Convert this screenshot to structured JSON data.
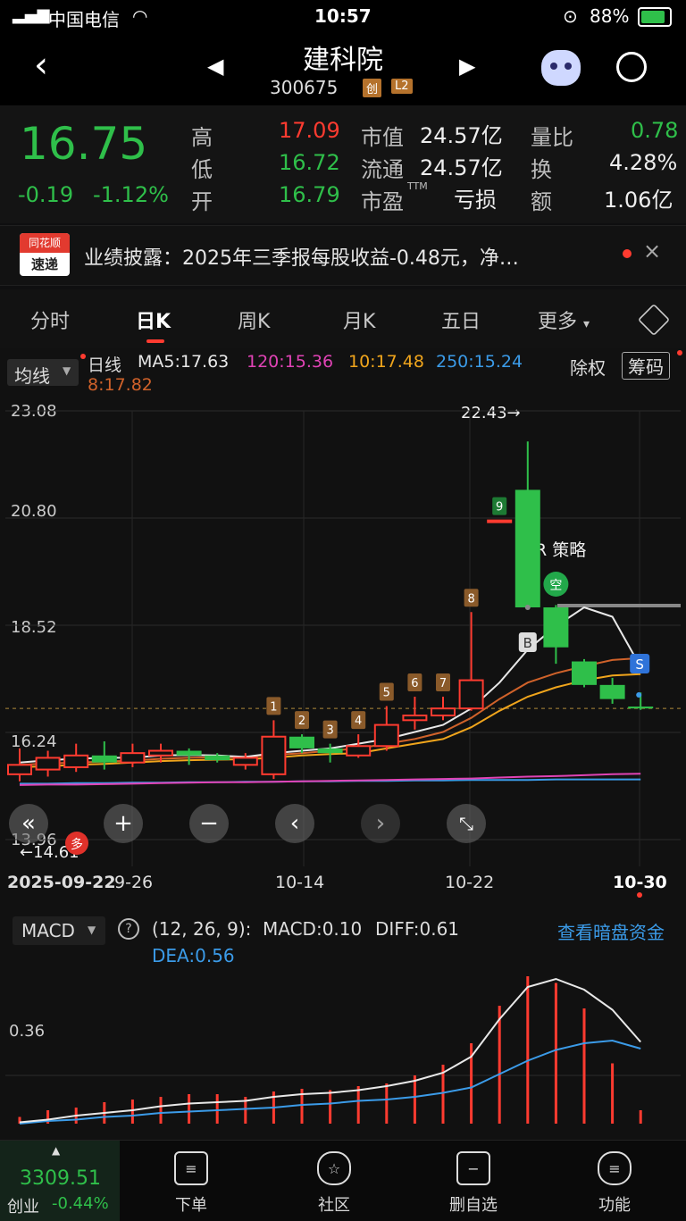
{
  "status": {
    "carrier": "中国电信",
    "time": "10:57",
    "battery": "88%"
  },
  "nav": {
    "title": "建科院",
    "code": "300675",
    "badge1": "创",
    "badge2": "L2"
  },
  "quote": {
    "price": "16.75",
    "change": "-0.19",
    "change_pct": "-1.12%",
    "rows": [
      {
        "l1": "高",
        "v1": "17.09",
        "l2": "市值",
        "v2": "24.57亿",
        "l3": "量比",
        "v3": "0.78"
      },
      {
        "l1": "低",
        "v1": "16.72",
        "l2": "流通",
        "v2": "24.57亿",
        "l3": "换",
        "v3": "4.28%"
      },
      {
        "l1": "开",
        "v1": "16.79",
        "l2": "市盈",
        "v2": "亏损",
        "l3": "额",
        "v3": "1.06亿"
      }
    ],
    "ttm": "TTM"
  },
  "news": {
    "logo_top": "同花顺",
    "logo_bottom": "速递",
    "text": "业绩披露：2025年三季报每股收益-0.48元，净…"
  },
  "tabs": [
    "分时",
    "日K",
    "周K",
    "月K",
    "五日",
    "更多"
  ],
  "legend": {
    "selector": "均线",
    "period": "日线",
    "ma5": "MA5:17.63",
    "ma120": "120:15.36",
    "ma10": "10:17.48",
    "ma250": "250:15.24",
    "ma8": "8:17.82",
    "btn1": "除权",
    "btn2": "筹码"
  },
  "axis": {
    "y_labels": [
      "23.08",
      "20.80",
      "18.52",
      "16.24",
      "13.96"
    ],
    "x_labels": [
      "2025-09-22",
      "9-26",
      "10-14",
      "10-22",
      "10-30"
    ],
    "hi_marker": "22.43→",
    "lo_marker": "←14.61"
  },
  "annotations": {
    "vr": "VR 策略",
    "buy": "B",
    "sell": "S",
    "kong": "空",
    "duo": "多",
    "counts": [
      "1",
      "2",
      "3",
      "4",
      "5",
      "6",
      "7",
      "8",
      "9"
    ]
  },
  "macd": {
    "selector": "MACD",
    "params": "(12, 26, 9):",
    "macd_val": "MACD:0.10",
    "diff": "DIFF:0.61",
    "dea": "DEA:0.56",
    "link": "查看暗盘资金",
    "y_label": "0.36"
  },
  "bottom": {
    "index_val": "3309.51",
    "index_name": "创业",
    "index_pct": "-0.44%",
    "items": [
      "下单",
      "社区",
      "删自选",
      "功能"
    ]
  },
  "chart_data": {
    "type": "candlestick",
    "ylim": [
      13.96,
      23.08
    ],
    "candles": [
      {
        "o": 15.35,
        "c": 15.55,
        "h": 15.9,
        "l": 15.2
      },
      {
        "o": 15.45,
        "c": 15.7,
        "h": 15.85,
        "l": 15.3
      },
      {
        "o": 15.5,
        "c": 15.75,
        "h": 16.0,
        "l": 15.4
      },
      {
        "o": 15.75,
        "c": 15.6,
        "h": 16.05,
        "l": 15.45
      },
      {
        "o": 15.6,
        "c": 15.8,
        "h": 16.0,
        "l": 15.5
      },
      {
        "o": 15.75,
        "c": 15.85,
        "h": 16.0,
        "l": 15.6
      },
      {
        "o": 15.85,
        "c": 15.75,
        "h": 15.9,
        "l": 15.55
      },
      {
        "o": 15.75,
        "c": 15.65,
        "h": 15.8,
        "l": 15.6
      },
      {
        "o": 15.55,
        "c": 15.7,
        "h": 15.8,
        "l": 15.45
      },
      {
        "o": 15.35,
        "c": 16.15,
        "h": 16.5,
        "l": 15.25
      },
      {
        "o": 16.15,
        "c": 15.9,
        "h": 16.2,
        "l": 15.8
      },
      {
        "o": 15.9,
        "c": 15.8,
        "h": 16.0,
        "l": 15.6
      },
      {
        "o": 15.75,
        "c": 15.95,
        "h": 16.2,
        "l": 15.7
      },
      {
        "o": 15.95,
        "c": 16.4,
        "h": 16.8,
        "l": 15.85
      },
      {
        "o": 16.5,
        "c": 16.6,
        "h": 17.0,
        "l": 16.3
      },
      {
        "o": 16.6,
        "c": 16.75,
        "h": 17.0,
        "l": 16.5
      },
      {
        "o": 16.75,
        "c": 17.35,
        "h": 18.8,
        "l": 16.7
      },
      {
        "o": 20.75,
        "c": 20.75,
        "h": 20.75,
        "l": 20.75
      },
      {
        "o": 21.4,
        "c": 18.9,
        "h": 22.43,
        "l": 18.85
      },
      {
        "o": 18.9,
        "c": 18.05,
        "h": 18.95,
        "l": 17.7
      },
      {
        "o": 17.75,
        "c": 17.25,
        "h": 17.8,
        "l": 17.2
      },
      {
        "o": 17.25,
        "c": 16.95,
        "h": 17.4,
        "l": 16.85
      },
      {
        "o": 16.79,
        "c": 16.75,
        "h": 17.09,
        "l": 16.72
      }
    ],
    "ma5": [
      15.6,
      15.65,
      15.68,
      15.7,
      15.7,
      15.75,
      15.76,
      15.75,
      15.72,
      15.8,
      15.85,
      15.9,
      16.0,
      16.1,
      16.25,
      16.4,
      16.75,
      17.3,
      18.0,
      18.5,
      18.9,
      18.7,
      17.63
    ],
    "ma10": [
      15.5,
      15.52,
      15.55,
      15.57,
      15.6,
      15.63,
      15.65,
      15.66,
      15.67,
      15.7,
      15.75,
      15.78,
      15.8,
      15.9,
      16.0,
      16.1,
      16.35,
      16.7,
      17.0,
      17.2,
      17.35,
      17.45,
      17.48
    ],
    "ma8": [
      15.55,
      15.58,
      15.6,
      15.62,
      15.64,
      15.68,
      15.7,
      15.71,
      15.72,
      15.76,
      15.8,
      15.85,
      15.9,
      16.0,
      16.1,
      16.25,
      16.55,
      16.95,
      17.3,
      17.5,
      17.65,
      17.78,
      17.82
    ],
    "ma120": [
      15.12,
      15.13,
      15.13,
      15.14,
      15.15,
      15.16,
      15.17,
      15.18,
      15.18,
      15.19,
      15.2,
      15.21,
      15.22,
      15.23,
      15.24,
      15.25,
      15.26,
      15.28,
      15.3,
      15.31,
      15.33,
      15.35,
      15.36
    ],
    "ma250": [
      15.15,
      15.15,
      15.16,
      15.16,
      15.17,
      15.17,
      15.18,
      15.18,
      15.19,
      15.19,
      15.2,
      15.2,
      15.21,
      15.21,
      15.22,
      15.22,
      15.23,
      15.23,
      15.23,
      15.24,
      15.24,
      15.24,
      15.24
    ],
    "macd_bars": [
      0.05,
      0.1,
      0.12,
      0.16,
      0.18,
      0.2,
      0.22,
      0.22,
      0.2,
      0.24,
      0.26,
      0.25,
      0.28,
      0.3,
      0.36,
      0.44,
      0.6,
      0.88,
      1.1,
      1.05,
      0.86,
      0.45,
      0.1
    ],
    "diff": [
      0.01,
      0.03,
      0.06,
      0.08,
      0.1,
      0.13,
      0.15,
      0.16,
      0.17,
      0.2,
      0.22,
      0.23,
      0.25,
      0.28,
      0.32,
      0.38,
      0.5,
      0.78,
      1.02,
      1.08,
      1.0,
      0.85,
      0.61
    ],
    "dea": [
      0.0,
      0.02,
      0.03,
      0.05,
      0.06,
      0.08,
      0.09,
      0.1,
      0.11,
      0.12,
      0.14,
      0.15,
      0.17,
      0.18,
      0.2,
      0.23,
      0.27,
      0.37,
      0.47,
      0.55,
      0.6,
      0.62,
      0.56
    ]
  }
}
